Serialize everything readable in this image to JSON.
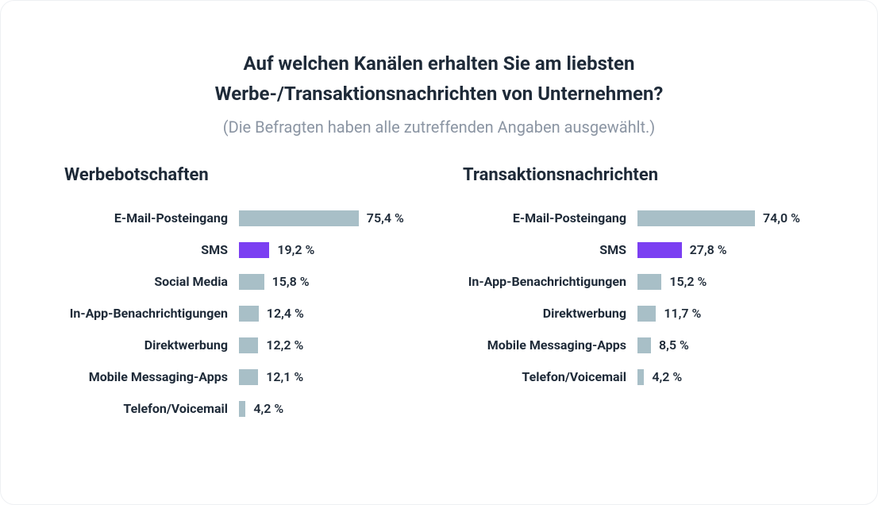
{
  "title": "Auf welchen Kanälen erhalten Sie am liebsten Werbe-/Transaktionsnachrichten von Unternehmen?",
  "subtitle": "(Die Befragten haben alle zutreffenden Angaben ausgewählt.)",
  "chart_data": [
    {
      "type": "bar",
      "heading": "Werbebotschaften",
      "axis_max": 100,
      "rows": [
        {
          "label": "E-Mail-Posteingang",
          "value": 75.4,
          "display": "75,4 %",
          "highlight": false
        },
        {
          "label": "SMS",
          "value": 19.2,
          "display": "19,2 %",
          "highlight": true
        },
        {
          "label": "Social Media",
          "value": 15.8,
          "display": "15,8 %",
          "highlight": false
        },
        {
          "label": "In-App-Benachrichtigungen",
          "value": 12.4,
          "display": "12,4 %",
          "highlight": false
        },
        {
          "label": "Direktwerbung",
          "value": 12.2,
          "display": "12,2 %",
          "highlight": false
        },
        {
          "label": "Mobile Messaging-Apps",
          "value": 12.1,
          "display": "12,1 %",
          "highlight": false
        },
        {
          "label": "Telefon/Voicemail",
          "value": 4.2,
          "display": "4,2 %",
          "highlight": false
        }
      ]
    },
    {
      "type": "bar",
      "heading": "Transaktionsnachrichten",
      "axis_max": 100,
      "rows": [
        {
          "label": "E-Mail-Posteingang",
          "value": 74.0,
          "display": "74,0 %",
          "highlight": false
        },
        {
          "label": "SMS",
          "value": 27.8,
          "display": "27,8 %",
          "highlight": true
        },
        {
          "label": "In-App-Benachrichtigungen",
          "value": 15.2,
          "display": "15,2 %",
          "highlight": false
        },
        {
          "label": "Direktwerbung",
          "value": 11.7,
          "display": "11,7 %",
          "highlight": false
        },
        {
          "label": "Mobile Messaging-Apps",
          "value": 8.5,
          "display": "8,5 %",
          "highlight": false
        },
        {
          "label": "Telefon/Voicemail",
          "value": 4.2,
          "display": "4,2 %",
          "highlight": false
        }
      ]
    }
  ],
  "colors": {
    "bar_default": "#a8bfc7",
    "bar_highlight": "#7b3ff2",
    "text_primary": "#1e2a38",
    "text_muted": "#8b95a3"
  },
  "bar_pixel_scale": 2.0
}
